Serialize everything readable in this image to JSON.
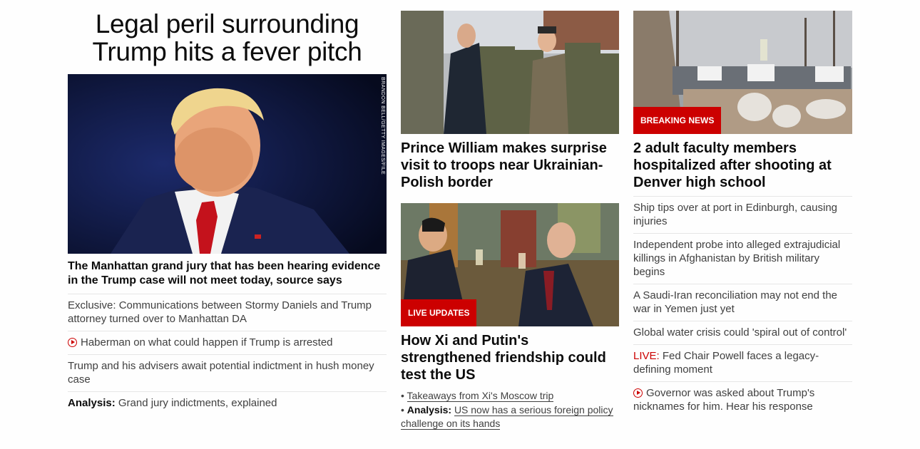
{
  "lead": {
    "headline": "Legal peril surrounding Trump hits a fever pitch",
    "image_credit": "BRANDON BELL/GETTY IMAGES/FILE",
    "text": "The Manhattan grand jury that has been hearing evidence in the Trump case will not meet today, source says",
    "items": [
      {
        "text": "Exclusive: Communications between Stormy Daniels and Trump attorney turned over to Manhattan DA"
      },
      {
        "text": "Haberman on what could happen if Trump is arrested",
        "icon": "play-icon"
      },
      {
        "text": "Trump and his advisers await potential indictment in hush money case"
      },
      {
        "prefix": "Analysis:",
        "text": " Grand jury indictments, explained"
      }
    ]
  },
  "middle": {
    "story1": {
      "title": "Prince William makes surprise visit to troops near Ukrainian-Polish border"
    },
    "story2": {
      "badge": "LIVE UPDATES",
      "title": "How Xi and Putin's strengthened friendship could test the US",
      "bullets": [
        {
          "text": "Takeaways from Xi's Moscow trip"
        },
        {
          "prefix": "Analysis:",
          "text": "US now has a serious foreign policy challenge on its hands"
        }
      ]
    }
  },
  "right": {
    "badge": "BREAKING NEWS",
    "title": "2 adult faculty members hospitalized after shooting at Denver high school",
    "items": [
      {
        "text": "Ship tips over at port in Edinburgh, causing injuries"
      },
      {
        "text": "Independent probe into alleged extrajudicial killings in Afghanistan by British military begins"
      },
      {
        "text": "A Saudi-Iran reconciliation may not end the war in Yemen just yet"
      },
      {
        "text": "Global water crisis could 'spiral out of control'"
      },
      {
        "prefix": "LIVE:",
        "text": " Fed Chair Powell faces a legacy-defining moment"
      },
      {
        "text": "Governor was asked about Trump's nicknames for him. Hear his response",
        "icon": "play-icon"
      }
    ]
  },
  "colors": {
    "accent": "#cc0000",
    "text": "#0c0c0c",
    "secondary": "#404040",
    "divider": "#e6e6e6"
  }
}
